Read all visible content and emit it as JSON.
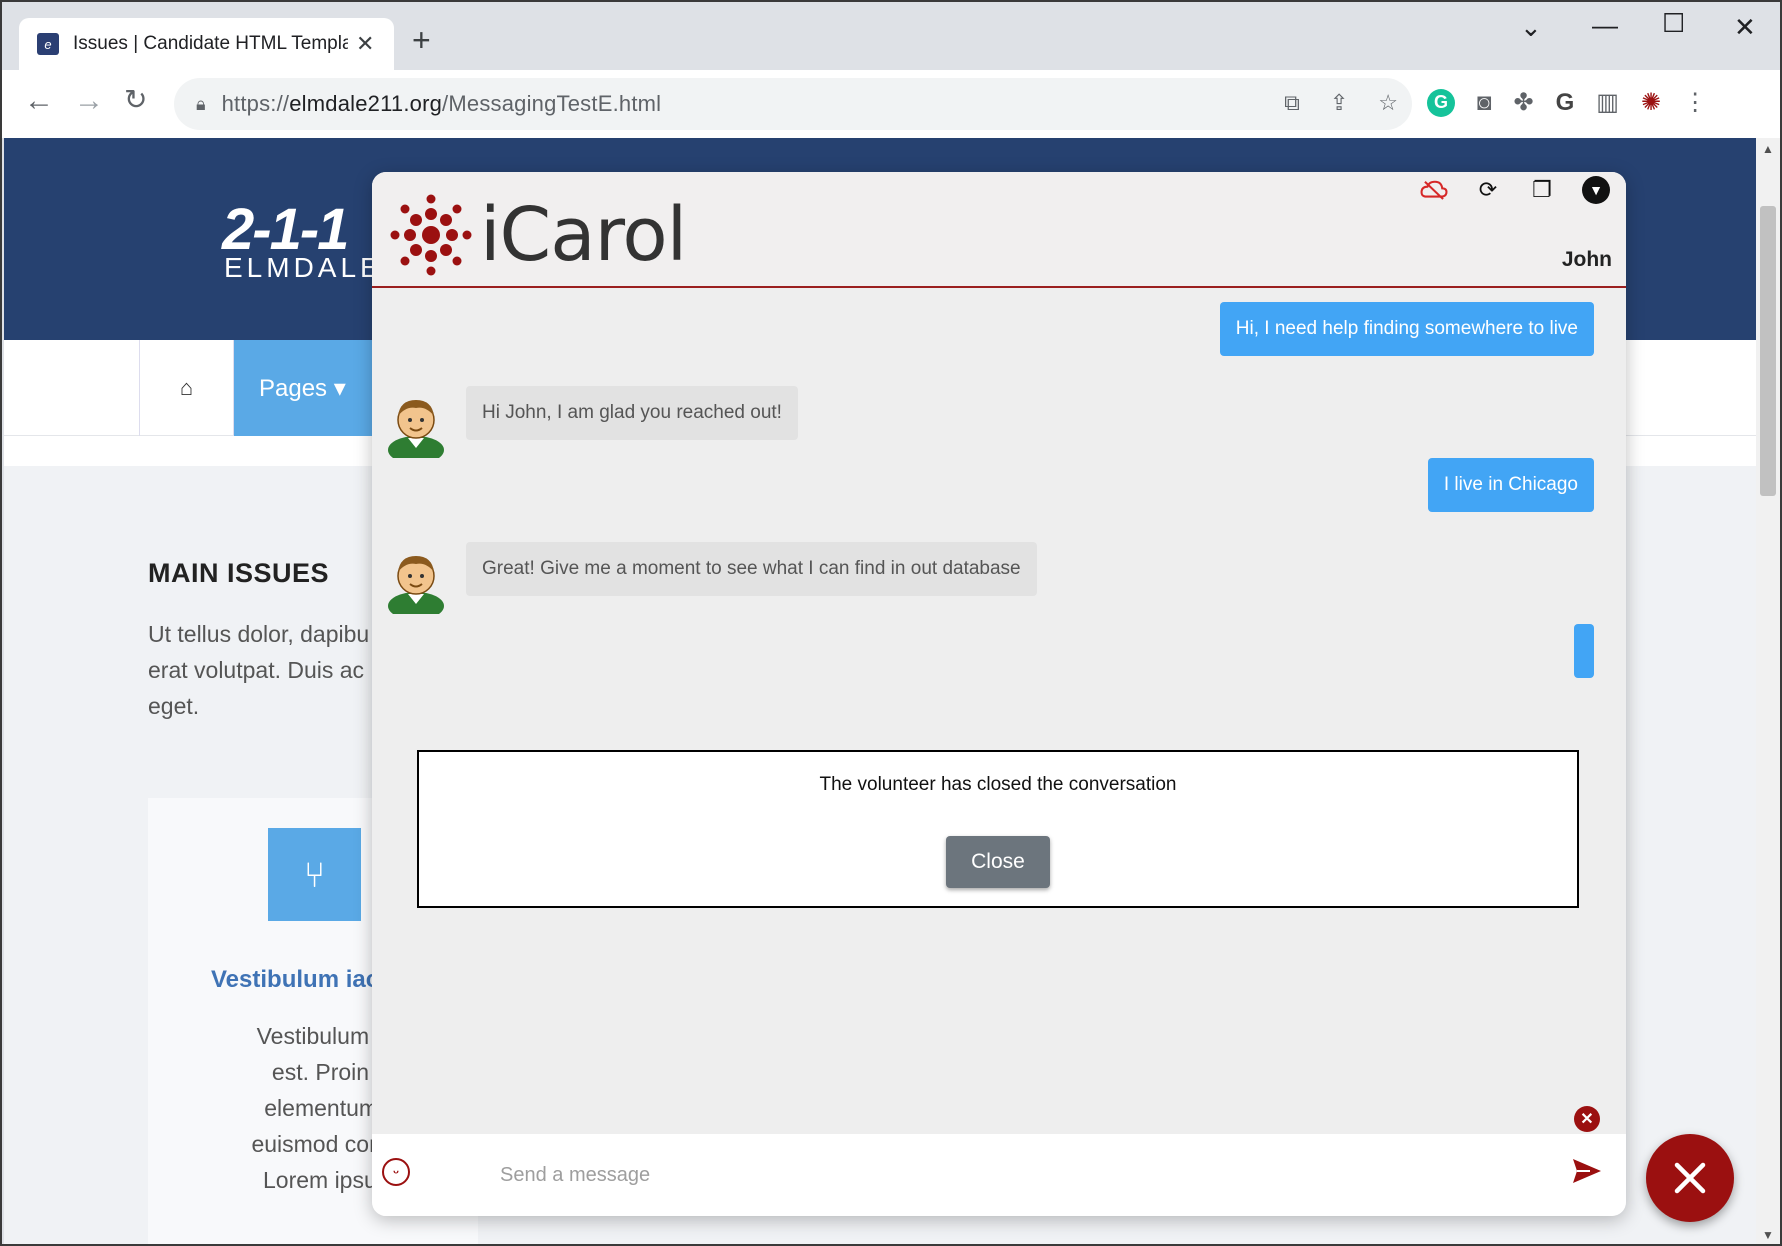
{
  "browser": {
    "tab_title": "Issues | Candidate HTML Templat",
    "tab_close": "✕",
    "new_tab": "+",
    "url_prefix": "https://",
    "url_host": "elmdale211.org",
    "url_path": "/MessagingTestE.html",
    "controls": {
      "chevron": "⌄",
      "minimize": "—",
      "maximize": "☐",
      "close": "✕"
    }
  },
  "site": {
    "logo": "2-1-1",
    "logo_sub": "ELMDALE",
    "nav_home_icon": "home-icon",
    "nav_pages": "Pages ▾",
    "main_issues": "MAIN ISSUES",
    "intro_lines": [
      "Ut tellus dolor, dapibu",
      "erat volutpat. Duis ac",
      "eget."
    ],
    "card_title": "Vestibulum iac",
    "card_lines": [
      "Vestibulum iaculis",
      "est. Proin dictu",
      "elementum velit.",
      "euismod consequa",
      "Lorem ipsum dol"
    ]
  },
  "chat": {
    "brand_name": "iCarol",
    "brand_color": "#9b1010",
    "user_name": "John",
    "messages": [
      {
        "from": "user",
        "text": "Hi, I need help finding somewhere to live"
      },
      {
        "from": "agent",
        "text": "Hi John, I am glad you reached out!"
      },
      {
        "from": "user",
        "text": "I live in Chicago"
      },
      {
        "from": "agent",
        "text": "Great! Give me a moment to see what I can find in out database"
      }
    ],
    "notice_text": "The volunteer has closed the conversation",
    "notice_button": "Close",
    "input_placeholder": "Send a message",
    "accent": "#42a5f5"
  }
}
